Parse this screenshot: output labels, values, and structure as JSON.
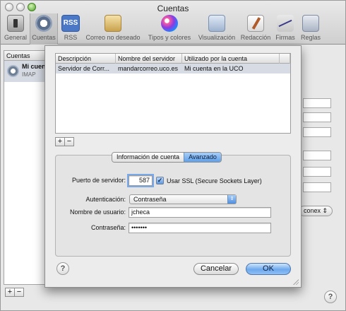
{
  "window": {
    "title": "Cuentas"
  },
  "toolbar": {
    "items": [
      {
        "label": "General",
        "icon": "general-icon"
      },
      {
        "label": "Cuentas",
        "icon": "at-sign-icon",
        "active": true
      },
      {
        "label": "RSS",
        "icon": "rss-icon",
        "badge": "RSS"
      },
      {
        "label": "Correo no deseado",
        "icon": "junk-mail-icon"
      },
      {
        "label": "Tipos y colores",
        "icon": "fonts-colors-icon"
      },
      {
        "label": "Visualización",
        "icon": "viewing-icon"
      },
      {
        "label": "Redacción",
        "icon": "composing-icon"
      },
      {
        "label": "Firmas",
        "icon": "signatures-icon"
      },
      {
        "label": "Reglas",
        "icon": "rules-icon"
      }
    ]
  },
  "accounts": {
    "header": "Cuentas",
    "items": [
      {
        "name": "Mi cuen",
        "type": "IMAP"
      }
    ]
  },
  "background": {
    "popup_value": "conex"
  },
  "sheet": {
    "table": {
      "columns": [
        "Descripción",
        "Nombre del servidor",
        "Utilizado por la cuenta"
      ],
      "rows": [
        [
          "Servidor de Corr...",
          "mandarcorreo.uco.es",
          "Mi cuenta en la UCO"
        ]
      ]
    },
    "tabs": [
      {
        "label": "Información de cuenta",
        "selected": false
      },
      {
        "label": "Avanzado",
        "selected": true
      }
    ],
    "advanced": {
      "port_label": "Puerto de servidor:",
      "port_value": "587",
      "ssl_checked": true,
      "ssl_label": "Usar SSL (Secure Sockets Layer)",
      "auth_label": "Autenticación:",
      "auth_value": "Contraseña",
      "username_label": "Nombre de usuario:",
      "username_value": "jcheca",
      "password_label": "Contraseña:",
      "password_value": "•••••••"
    },
    "buttons": {
      "cancel": "Cancelar",
      "ok": "OK"
    },
    "help": "?"
  },
  "footer": {
    "add": "+",
    "remove": "−",
    "help": "?"
  },
  "colors": {
    "accent": "#5ea0ea",
    "selection_row": "#d6dbe4"
  }
}
